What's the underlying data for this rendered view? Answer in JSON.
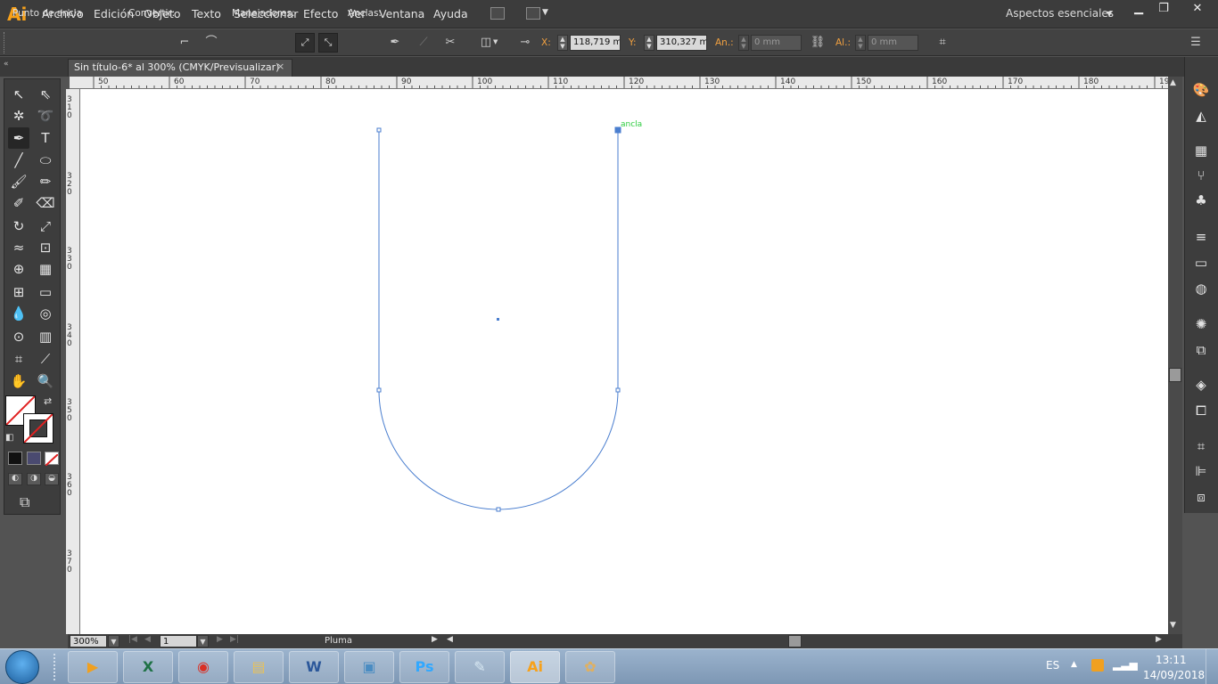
{
  "app": {
    "logo": "Ai",
    "accent": "#f7a11a"
  },
  "menu": [
    "Archivo",
    "Edición",
    "Objeto",
    "Texto",
    "Seleccionar",
    "Efecto",
    "Ver",
    "Ventana",
    "Ayuda"
  ],
  "workspace_label": "Aspectos esenciales",
  "control_bar": {
    "context_label": "Punto de ancla",
    "convert_label": "Convertir:",
    "handles_label": "Manejadores:",
    "anchors_label": "Anclas:",
    "x_label": "X:",
    "x_value": "118,719 mm",
    "y_label": "Y:",
    "y_value": "310,327 mm",
    "w_label": "An.:",
    "w_value": "0 mm",
    "h_label": "Al.:",
    "h_value": "0 mm"
  },
  "document_tab": {
    "title": "Sin título-6* al 300% (CMYK/Previsualizar)",
    "close": "×"
  },
  "ruler_h": [
    "50",
    "60",
    "70",
    "80",
    "90",
    "100",
    "110",
    "120",
    "130",
    "140",
    "150",
    "160",
    "170",
    "180",
    "19"
  ],
  "ruler_v": [
    "3\n1\n0",
    "3\n2\n0",
    "3\n3\n0",
    "3\n4\n0",
    "3\n5\n0",
    "3\n6\n0",
    "3\n7\n0"
  ],
  "canvas": {
    "anchor_hint": "ancla",
    "path_color": "#4a7ecf",
    "hint_color": "#2ecc40"
  },
  "status": {
    "zoom": "300%",
    "artboard": "1",
    "tool_name": "Pluma"
  },
  "taskbar": {
    "apps": [
      {
        "name": "media-player",
        "glyph": "▶",
        "color": "#f0a020"
      },
      {
        "name": "excel",
        "glyph": "X",
        "color": "#1e7145"
      },
      {
        "name": "chrome",
        "glyph": "◉",
        "color": "#d93025"
      },
      {
        "name": "file-explorer",
        "glyph": "▤",
        "color": "#e8c15a"
      },
      {
        "name": "word",
        "glyph": "W",
        "color": "#2b579a"
      },
      {
        "name": "photo-viewer",
        "glyph": "▣",
        "color": "#4a8cc2"
      },
      {
        "name": "photoshop",
        "glyph": "Ps",
        "color": "#31a8ff"
      },
      {
        "name": "notes",
        "glyph": "✎",
        "color": "#d8e8f2"
      },
      {
        "name": "illustrator",
        "glyph": "Ai",
        "color": "#f7a11a"
      },
      {
        "name": "paint",
        "glyph": "✿",
        "color": "#e0b060"
      }
    ],
    "language": "ES",
    "time": "13:11",
    "date": "14/09/2018"
  }
}
